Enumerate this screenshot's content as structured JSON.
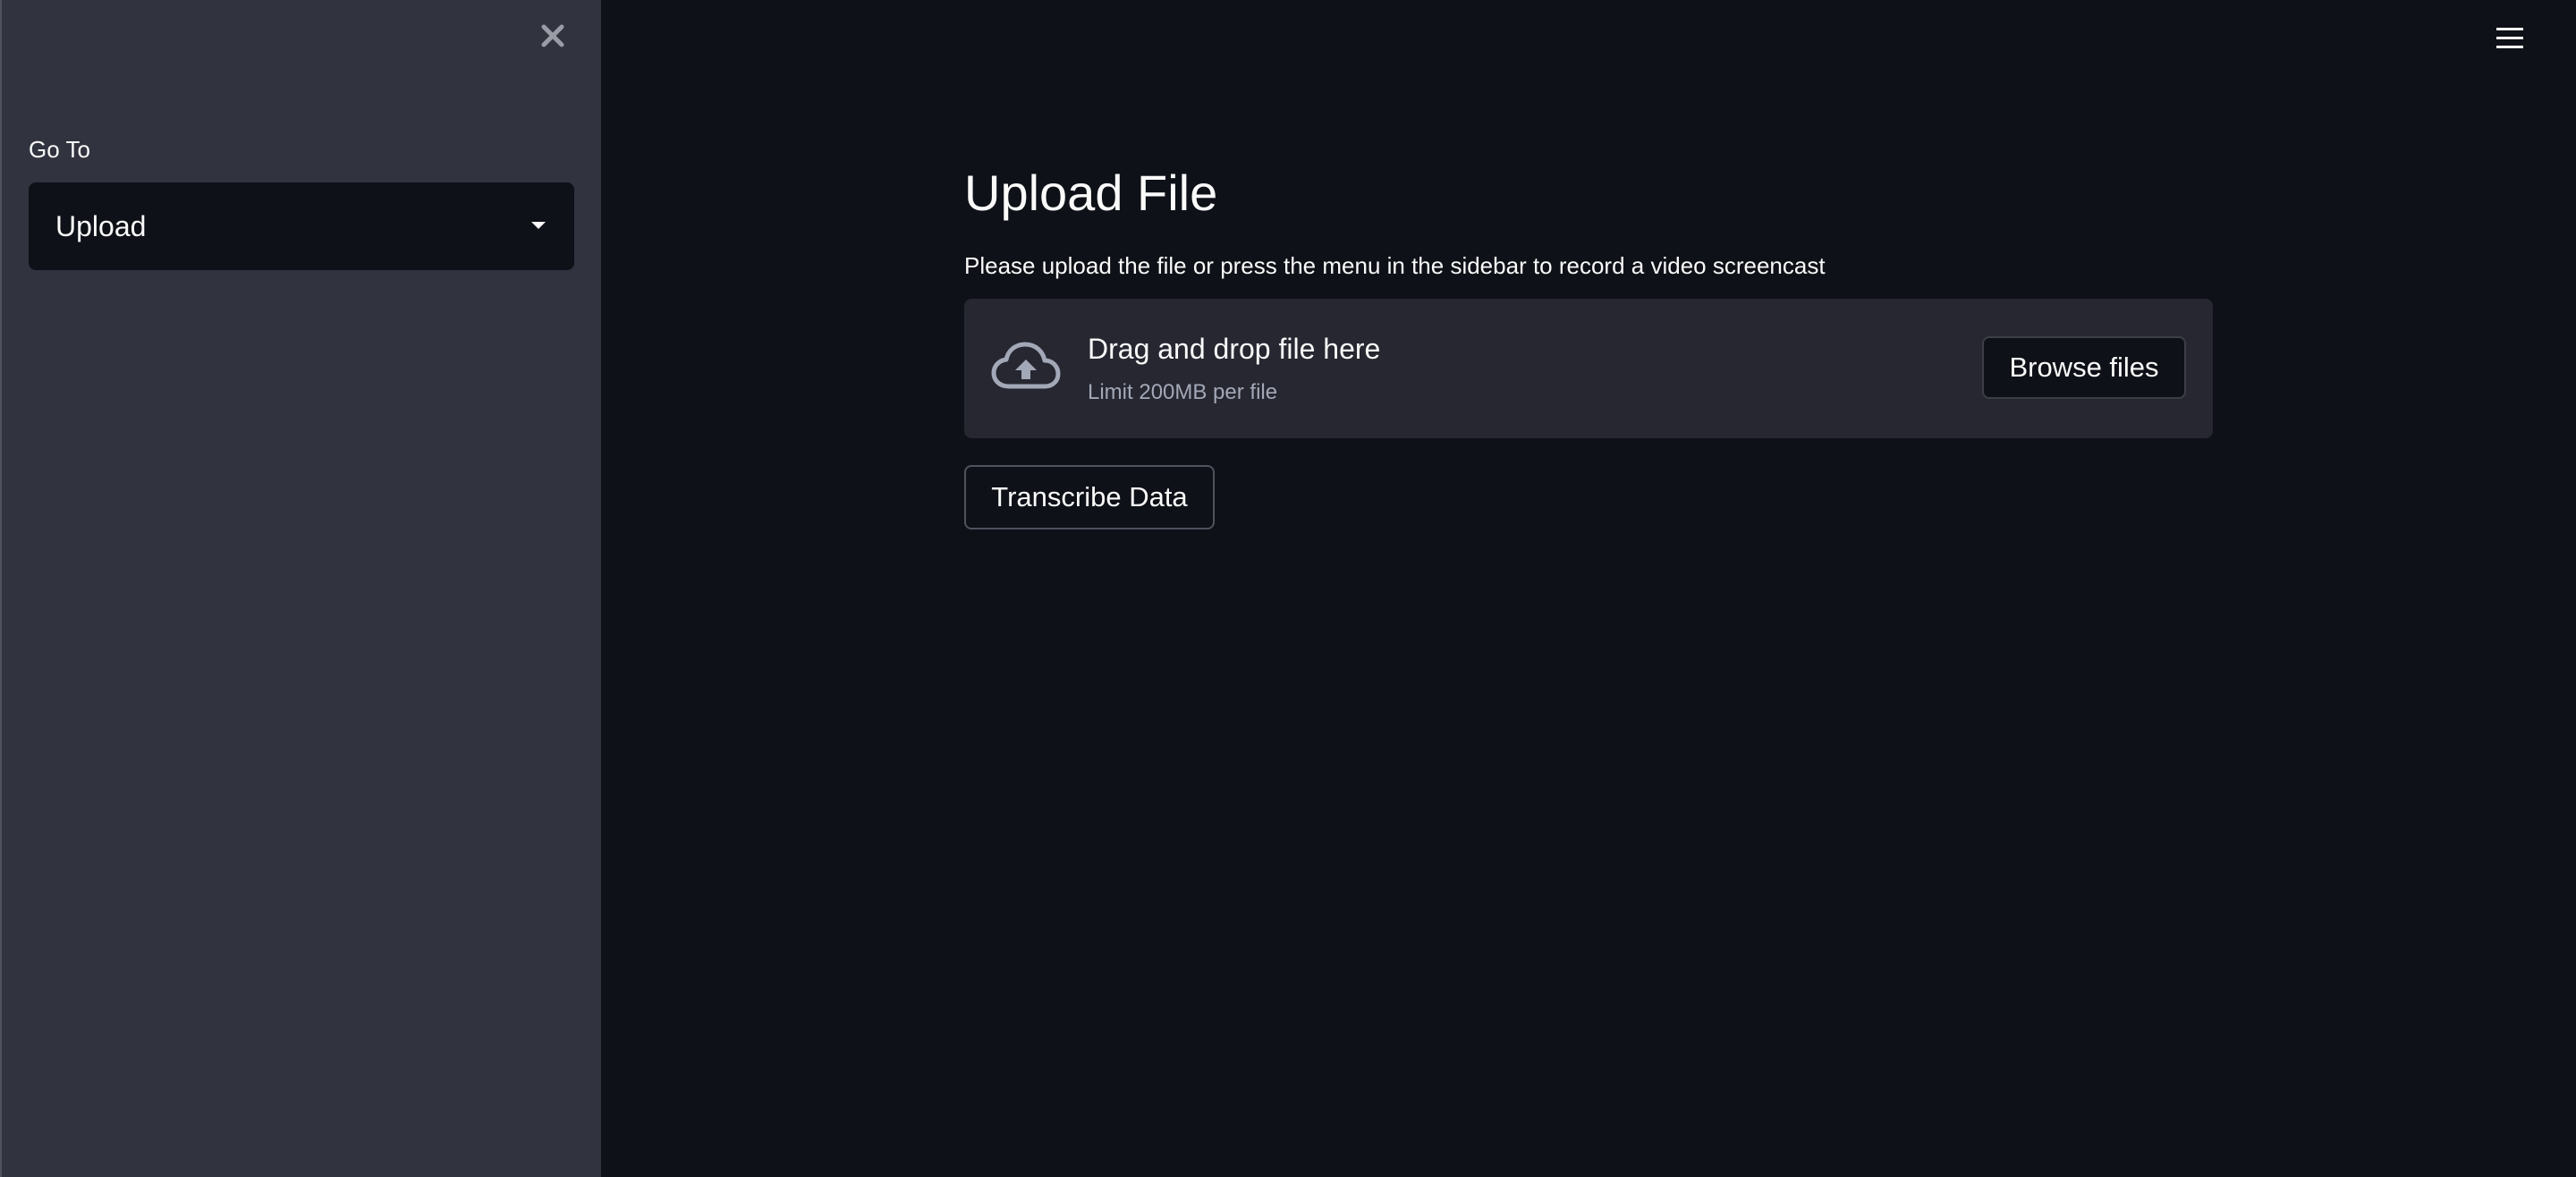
{
  "sidebar": {
    "label": "Go To",
    "select": {
      "value": "Upload"
    },
    "close_icon": "close-icon"
  },
  "header": {
    "menu_icon": "hamburger-menu-icon"
  },
  "main": {
    "title": "Upload File",
    "subtitle": "Please upload the file or press the menu in the sidebar to record a video screencast",
    "uploader": {
      "icon": "cloud-upload-icon",
      "title": "Drag and drop file here",
      "limit": "Limit 200MB per file",
      "browse_label": "Browse files"
    },
    "transcribe_label": "Transcribe Data"
  },
  "colors": {
    "sidebar_bg": "#31333f",
    "main_bg": "#0e1117",
    "dropzone_bg": "#262730",
    "text": "#fafafa",
    "muted_text": "#a3a8b8"
  }
}
